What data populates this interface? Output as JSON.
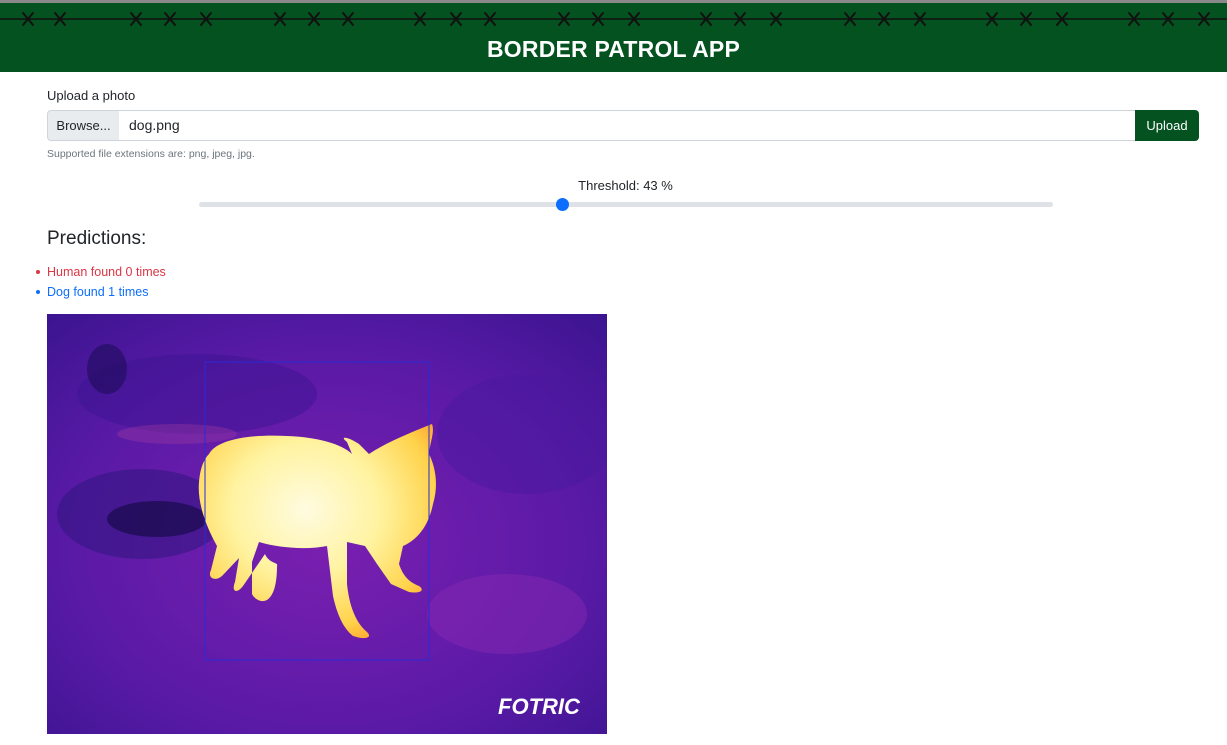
{
  "header": {
    "title": "BORDER PATROL APP"
  },
  "upload": {
    "label": "Upload a photo",
    "browse_label": "Browse...",
    "file_value": "dog.png",
    "button_label": "Upload",
    "help_text": "Supported file extensions are: png, jpeg, jpg."
  },
  "threshold": {
    "label": "Threshold: 43 %",
    "value_percent": 43
  },
  "predictions": {
    "title": "Predictions:",
    "items": [
      {
        "label": "Human found 0 times",
        "color": "#dc3545"
      },
      {
        "label": "Dog found 1 times",
        "color": "#0d6efd"
      }
    ]
  },
  "result_image": {
    "watermark": "FOTRIC",
    "box_color": "#2a2ad6"
  },
  "colors": {
    "brand": "#04521f",
    "accent": "#0d6efd"
  }
}
